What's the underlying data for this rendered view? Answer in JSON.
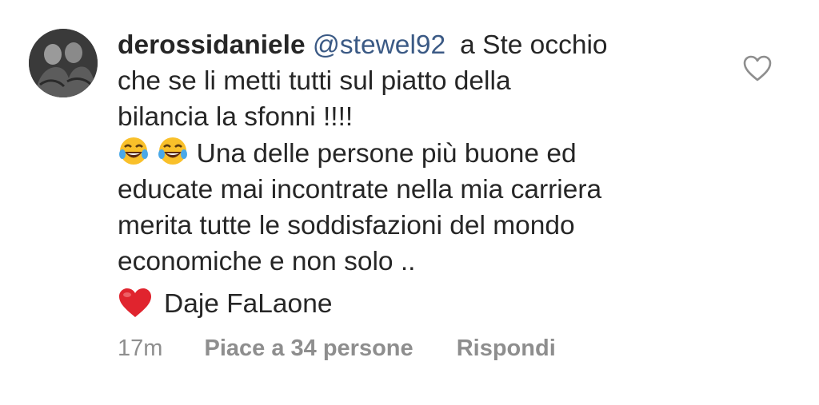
{
  "comment": {
    "username": "derossidaniele",
    "mention": "@stewel92",
    "text_line1": "a Ste occhio",
    "text_line2": "che se li metti tutti sul piatto della",
    "text_line3": "bilancia la sfonni !!!!",
    "text_line4": "Una delle persone più buone ed",
    "text_line5": "educate mai incontrate nella mia carriera",
    "text_line6": "merita tutte le soddisfazioni del mondo",
    "text_line7": "economiche e non solo ..",
    "text_line8": "Daje FaLaone",
    "emoji_laugh": "tears-of-joy-emoji",
    "emoji_heart": "red-heart-emoji"
  },
  "meta": {
    "time": "17m",
    "likes": "Piace a 34 persone",
    "reply": "Rispondi"
  },
  "icons": {
    "like": "heart-outline-icon",
    "avatar": "profile-photo"
  },
  "colors": {
    "text": "#262626",
    "mention": "#3b5a85",
    "meta": "#8e8e8e",
    "heart_emoji": "#e0242e",
    "laugh_emoji": "#f9c02a"
  }
}
